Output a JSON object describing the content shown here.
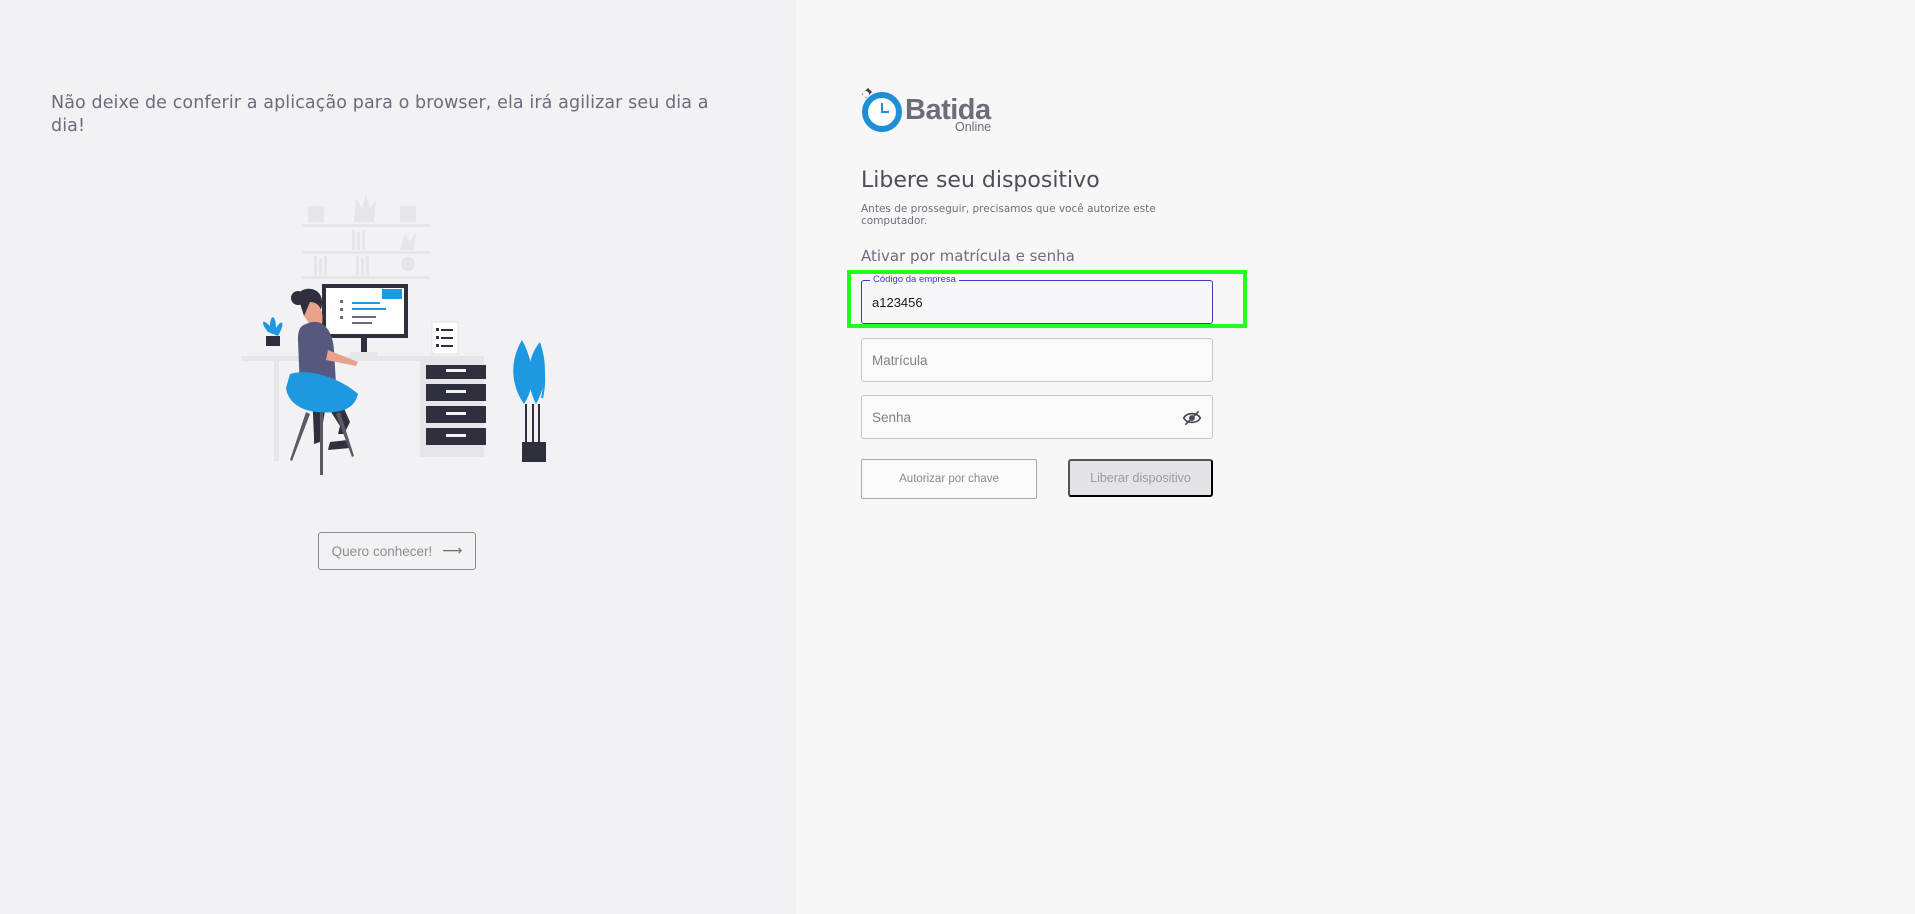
{
  "promo": {
    "text": "Não deixe de conferir a aplicação para o browser, ela irá agilizar seu dia a dia!",
    "cta_label": "Quero conhecer!",
    "cta_arrow": "⟶"
  },
  "logo": {
    "word": "Batida",
    "sub": "Online"
  },
  "form": {
    "title": "Libere seu dispositivo",
    "description": "Antes de prosseguir, precisamos que você autorize este computador.",
    "section_label": "Ativar por matrícula e senha",
    "fields": {
      "company_code": {
        "label": "Código da empresa",
        "value": "a123456"
      },
      "registration": {
        "placeholder": "Matrícula"
      },
      "password": {
        "placeholder": "Senha",
        "toggle_icon": "eye-off-icon"
      }
    },
    "buttons": {
      "authorize_by_key": "Autorizar por chave",
      "release_device": "Liberar dispositivo"
    }
  },
  "colors": {
    "accent": "#3b3dbf",
    "logo_blue": "#1c8fd6",
    "highlight": "#22ff1e",
    "illustration_blue": "#1e98e0"
  }
}
